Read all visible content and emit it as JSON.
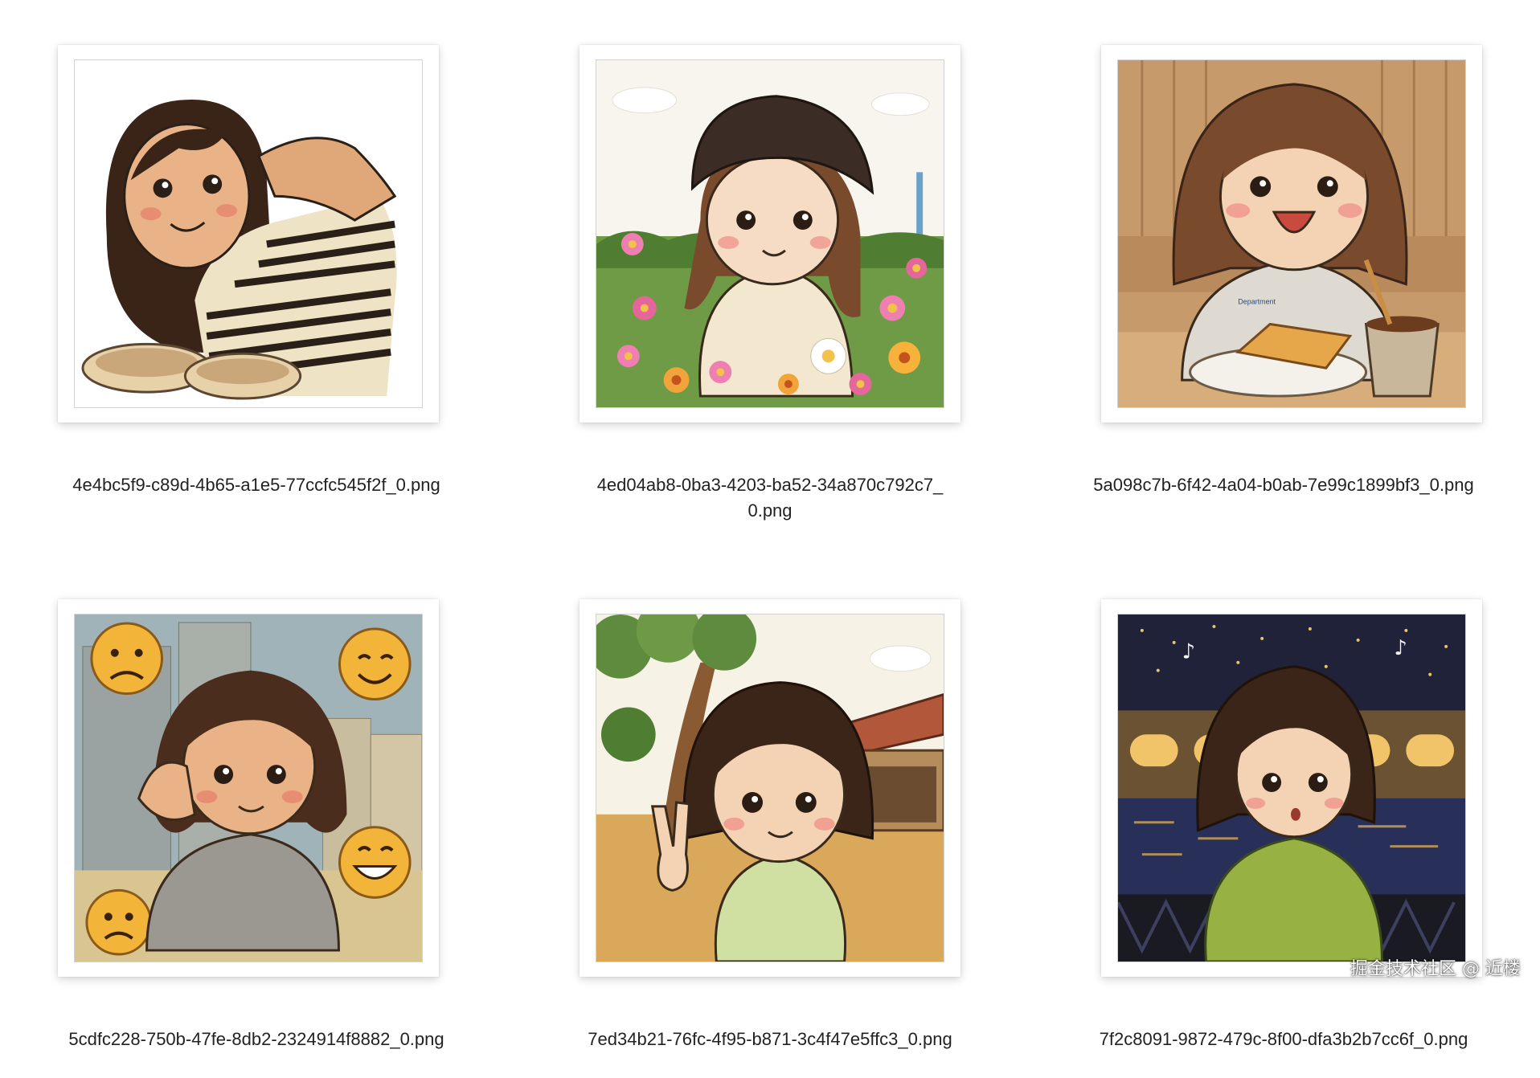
{
  "files": [
    {
      "name": "4e4bc5f9-c89d-4b65-a1e5-77ccfc545f2f_0.png",
      "thumb_icon": "girl-striped-shirt-peace-sign-thumbnail"
    },
    {
      "name": "4ed04ab8-0ba3-4203-ba52-34a870c792c7_0.png",
      "thumb_icon": "girl-beanie-flower-field-thumbnail"
    },
    {
      "name": "5a098c7b-6f42-4a04-b0ab-7e99c1899bf3_0.png",
      "thumb_icon": "girl-cafe-toast-coffee-thumbnail"
    },
    {
      "name": "5cdfc228-750b-47fe-8db2-2324914f8882_0.png",
      "thumb_icon": "girl-city-emoji-faces-thumbnail"
    },
    {
      "name": "7ed34b21-76fc-4f95-b871-3c4f47e5ffc3_0.png",
      "thumb_icon": "girl-park-peace-sign-thumbnail"
    },
    {
      "name": "7f2c8091-9872-479c-8f00-dfa3b2b7cc6f_0.png",
      "thumb_icon": "girl-night-city-river-thumbnail"
    }
  ],
  "watermark": "掘金技术社区 @ 近楼"
}
